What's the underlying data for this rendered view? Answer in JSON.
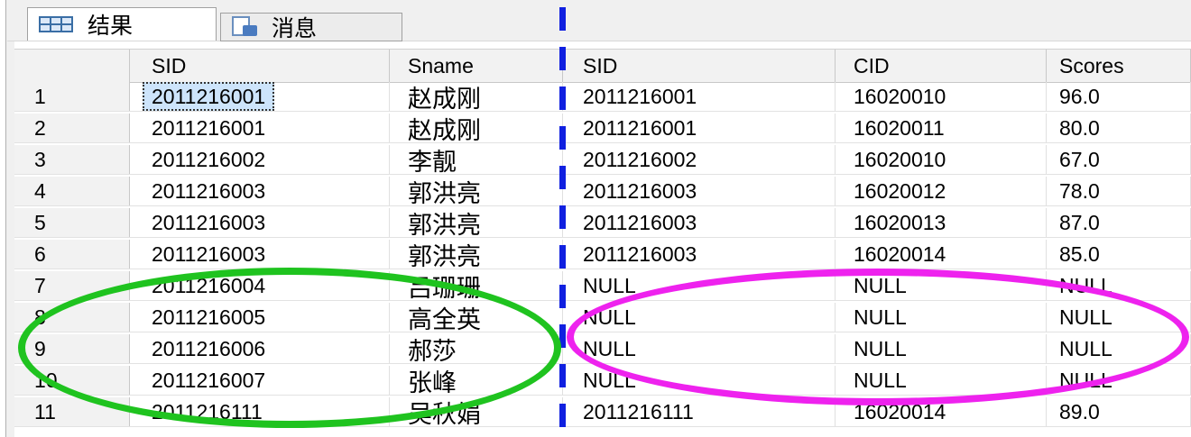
{
  "tabs": [
    {
      "label": "结果",
      "icon": "results-grid-icon",
      "active": true
    },
    {
      "label": "消息",
      "icon": "messages-icon",
      "active": false
    }
  ],
  "columns": [
    "",
    "SID",
    "Sname",
    "SID",
    "CID",
    "Scores"
  ],
  "rows": [
    [
      "1",
      "2011216001",
      "赵成刚",
      "2011216001",
      "16020010",
      "96.0"
    ],
    [
      "2",
      "2011216001",
      "赵成刚",
      "2011216001",
      "16020011",
      "80.0"
    ],
    [
      "3",
      "2011216002",
      "李靓",
      "2011216002",
      "16020010",
      "67.0"
    ],
    [
      "4",
      "2011216003",
      "郭洪亮",
      "2011216003",
      "16020012",
      "78.0"
    ],
    [
      "5",
      "2011216003",
      "郭洪亮",
      "2011216003",
      "16020013",
      "87.0"
    ],
    [
      "6",
      "2011216003",
      "郭洪亮",
      "2011216003",
      "16020014",
      "85.0"
    ],
    [
      "7",
      "2011216004",
      "吕珊珊",
      "NULL",
      "NULL",
      "NULL"
    ],
    [
      "8",
      "2011216005",
      "高全英",
      "NULL",
      "NULL",
      "NULL"
    ],
    [
      "9",
      "2011216006",
      "郝莎",
      "NULL",
      "NULL",
      "NULL"
    ],
    [
      "10",
      "2011216007",
      "张峰",
      "NULL",
      "NULL",
      "NULL"
    ],
    [
      "11",
      "2011216111",
      "吴秋娟",
      "2011216111",
      "16020014",
      "89.0"
    ]
  ],
  "selected_cell": {
    "row": 1,
    "column": "SID"
  },
  "annotations": {
    "divider_color": "#1020e0",
    "left_highlight_color": "#1fc31f",
    "right_highlight_color": "#ee22ee"
  }
}
